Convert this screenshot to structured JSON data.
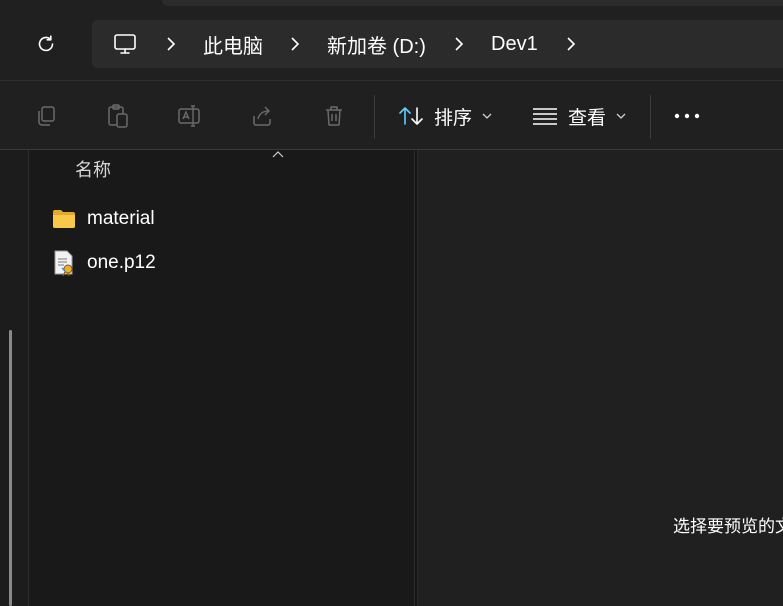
{
  "breadcrumb": {
    "items": [
      {
        "label": "此电脑"
      },
      {
        "label": "新加卷 (D:)"
      },
      {
        "label": "Dev1"
      }
    ]
  },
  "toolbar": {
    "sort_label": "排序",
    "view_label": "查看"
  },
  "file_list": {
    "column_name": "名称",
    "items": [
      {
        "name": "material",
        "icon": "folder-icon"
      },
      {
        "name": "one.p12",
        "icon": "certificate-file-icon"
      }
    ]
  },
  "preview": {
    "message": "选择要预览的文件。"
  },
  "colors": {
    "accent": "#60cdff",
    "folder": "#f8c84a",
    "background": "#191919"
  }
}
